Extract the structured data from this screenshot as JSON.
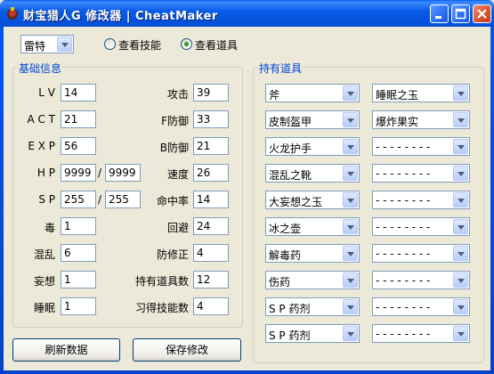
{
  "window": {
    "title": "财宝猎人G 修改器 | CheatMaker"
  },
  "character_select": {
    "value": "雷特"
  },
  "view_mode": {
    "options": [
      {
        "label": "查看技能",
        "checked": false
      },
      {
        "label": "查看道具",
        "checked": true
      }
    ]
  },
  "basic_info": {
    "title": "基础信息",
    "left": [
      {
        "label": "L V",
        "value": "14"
      },
      {
        "label": "A C T",
        "value": "21"
      },
      {
        "label": "E X P",
        "value": "56"
      },
      {
        "label": "H P",
        "value": "9999",
        "max": "9999"
      },
      {
        "label": "S P",
        "value": "255",
        "max": "255"
      },
      {
        "label": "毒",
        "value": "1"
      },
      {
        "label": "混乱",
        "value": "6"
      },
      {
        "label": "妄想",
        "value": "1"
      },
      {
        "label": "睡眠",
        "value": "1"
      }
    ],
    "right": [
      {
        "label": "攻击",
        "value": "39"
      },
      {
        "label": "F防御",
        "value": "33"
      },
      {
        "label": "B防御",
        "value": "21"
      },
      {
        "label": "速度",
        "value": "26"
      },
      {
        "label": "命中率",
        "value": "14"
      },
      {
        "label": "回避",
        "value": "24"
      },
      {
        "label": "防修正",
        "value": "4"
      },
      {
        "label": "持有道具数",
        "value": "12"
      },
      {
        "label": "习得技能数",
        "value": "4"
      }
    ],
    "separator": "/"
  },
  "items": {
    "title": "持有道具",
    "left": [
      "斧",
      "皮制盔甲",
      "火龙护手",
      "混乱之靴",
      "大妄想之玉",
      "冰之壶",
      "解毒药",
      "伤药",
      "S P 药剂",
      "S P 药剂"
    ],
    "right": [
      "睡眠之玉",
      "爆炸果实",
      "- - - - - - - -",
      "- - - - - - - -",
      "- - - - - - - -",
      "- - - - - - - -",
      "- - - - - - - -",
      "- - - - - - - -",
      "- - - - - - - -",
      "- - - - - - - -"
    ]
  },
  "buttons": {
    "refresh": "刷新数据",
    "save": "保存修改"
  },
  "colors": {
    "titlebar": "#0454e0",
    "window_bg": "#ece9d8",
    "group_title": "#0046d5"
  }
}
